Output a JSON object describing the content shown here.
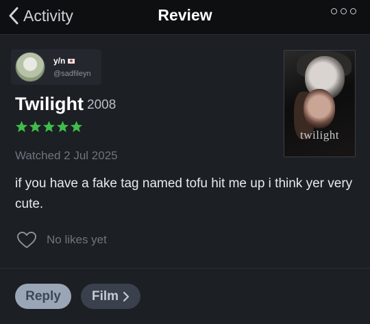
{
  "nav": {
    "back_label": "Activity",
    "title": "Review"
  },
  "author": {
    "username": "y/n",
    "handle": "@sadfileyn"
  },
  "film": {
    "title": "Twilight",
    "year": "2008",
    "rating_stars": 5,
    "rating_max": 5,
    "poster_title": "twilight"
  },
  "review": {
    "watched": "Watched 2 Jul 2025",
    "text": "if you have a fake tag named tofu hit me up i think yer very cute.",
    "likes": "No likes yet"
  },
  "actions": {
    "reply_label": "Reply",
    "film_label": "Film"
  },
  "colors": {
    "background": "#1c1f24",
    "topbar": "#0e0f11",
    "star_green": "#40bc4a",
    "reply_button": "#9aa6b6",
    "film_button": "#3a414c"
  }
}
